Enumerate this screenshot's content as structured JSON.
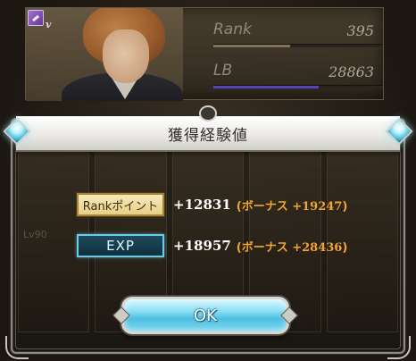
{
  "profile": {
    "type_badge_letter": "v",
    "rank_label": "Rank",
    "rank_value": "395",
    "rank_bar_fill": 0.45,
    "rank_bar_color": "#8a7a5c",
    "lb_label": "LB",
    "lb_value": "28863",
    "lb_bar_fill": 0.62,
    "lb_bar_color": "#5b46c8"
  },
  "dialog": {
    "title": "獲得経験値",
    "ghost_text": "Lv90",
    "rank_row": {
      "badge_label": "Rankポイント",
      "gain": "+12831",
      "bonus_prefix": "(ボーナス ",
      "bonus_value": "+19247",
      "bonus_suffix": ")"
    },
    "exp_row": {
      "badge_label": "EXP",
      "gain": "+18957",
      "bonus_prefix": "(ボーナス ",
      "bonus_value": "+28436",
      "bonus_suffix": ")"
    },
    "ok_label": "OK"
  },
  "colors": {
    "bonus": "#f3a533",
    "ok_button": "#4fbfe0",
    "rank_badge": "#e8cf86",
    "exp_badge_border": "#6ccbe6"
  }
}
